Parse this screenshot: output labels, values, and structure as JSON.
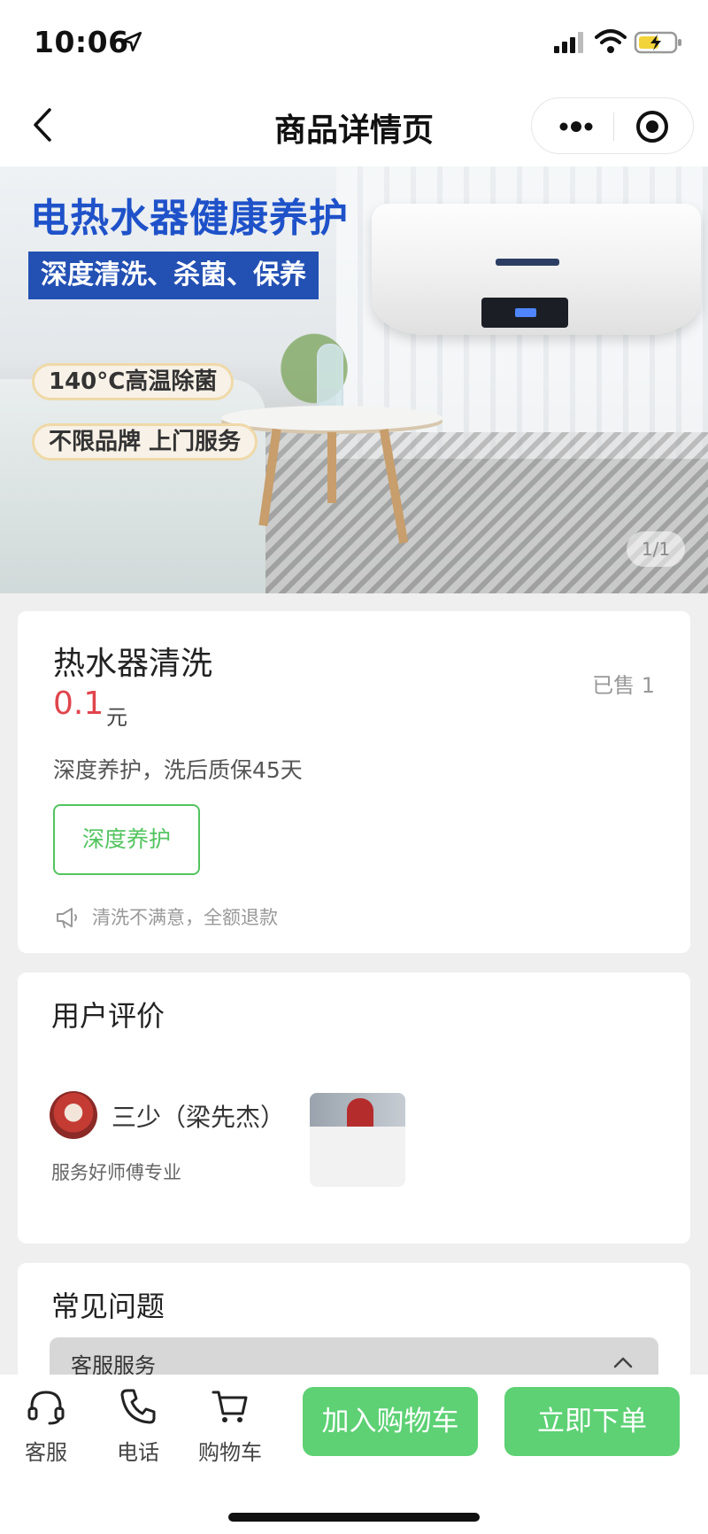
{
  "status_bar": {
    "time": "10:06"
  },
  "nav": {
    "title": "商品详情页"
  },
  "banner": {
    "headline": "电热水器健康养护",
    "subheadline": "深度清洗、杀菌、保养",
    "tags": [
      "140°C高温除菌",
      "不限品牌 上门服务"
    ],
    "counter": "1/1"
  },
  "product": {
    "name": "热水器清洗",
    "sold": "已售 1",
    "price": "0.1",
    "unit": "元",
    "description": "深度养护，洗后质保45天",
    "tag": "深度养护",
    "notice": "清洗不满意，全额退款"
  },
  "reviews": {
    "title": "用户评价",
    "items": [
      {
        "user": "三少（梁先杰）",
        "text": "服务好师傅专业"
      }
    ]
  },
  "faq": {
    "title": "常见问题",
    "items": [
      {
        "label": "客服服务"
      }
    ]
  },
  "bottom_bar": {
    "service_label": "客服",
    "phone_label": "电话",
    "cart_label": "购物车",
    "add_to_cart": "加入购物车",
    "buy_now": "立即下单",
    "accent_color": "#5dd174"
  }
}
